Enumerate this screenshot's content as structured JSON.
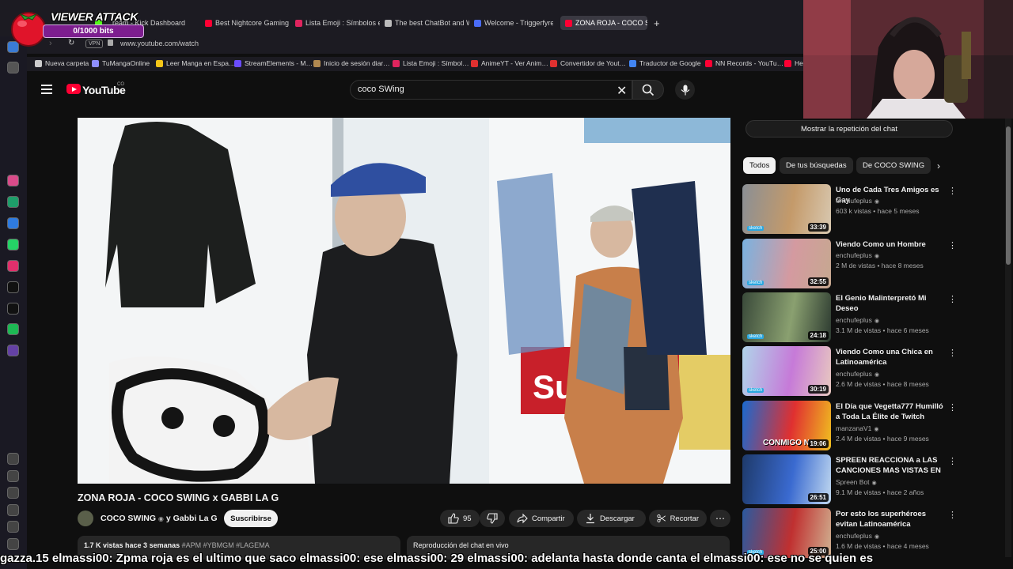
{
  "browser": {
    "tabs": [
      {
        "label": "…ream - Kick Dashboard",
        "color": "#53fc18"
      },
      {
        "label": "Best Nightcore Gaming M",
        "color": "#ff0033"
      },
      {
        "label": "Lista Emoji : Símbolos en",
        "color": "#e0245e"
      },
      {
        "label": "The best ChatBot and Wid",
        "color": "#bbbbbb"
      },
      {
        "label": "Welcome - Triggerfyre",
        "color": "#4a6cf7"
      },
      {
        "label": "ZONA ROJA - COCO S",
        "color": "#ff0033",
        "active": true
      }
    ],
    "new_tab": "+",
    "vpn_label": "VPN",
    "url": "www.youtube.com/watch",
    "bookmarks": [
      {
        "label": "Nueva carpeta",
        "color": "#cccccc"
      },
      {
        "label": "TuMangaOnline",
        "color": "#8f8fff"
      },
      {
        "label": "Leer Manga en Espa…",
        "color": "#f5c518"
      },
      {
        "label": "StreamElements - M…",
        "color": "#6a4cff"
      },
      {
        "label": "Inicio de sesión diar…",
        "color": "#b08850"
      },
      {
        "label": "Lista Emoji : Símbol…",
        "color": "#e0245e"
      },
      {
        "label": "AnimeYT - Ver Anim…",
        "color": "#e03030"
      },
      {
        "label": "Convertidor de Yout…",
        "color": "#e03030"
      },
      {
        "label": "Traductor de Google",
        "color": "#4285f4"
      },
      {
        "label": "NN Records - YouTu…",
        "color": "#ff0033"
      },
      {
        "label": "He",
        "color": "#ff0033"
      }
    ]
  },
  "sidebar_icons": [
    "home-icon",
    "pin-icon",
    "aria-icon",
    "chatgpt-icon",
    "messenger-icon",
    "whatsapp-icon",
    "instagram-icon",
    "tiktok-icon",
    "x-icon",
    "spotify-icon",
    "twitch-icon",
    "apps-icon",
    "heart-icon",
    "history-icon",
    "download-icon",
    "settings-icon",
    "more-icon"
  ],
  "youtube": {
    "wordmark": "YouTube",
    "country": "CO",
    "search_value": "coco SWing",
    "video": {
      "title": "ZONA ROJA - COCO SWING x GABBI LA G",
      "channel": "COCO SWING",
      "channel_suffix": "y Gabbi La G",
      "subscribe": "Suscribirse",
      "likes": "95",
      "share": "Compartir",
      "download": "Descargar",
      "clip": "Recortar",
      "more": "⋯",
      "views": "1.7 K vistas",
      "age": "hace 3 semanas",
      "tags": "#APM #YBMGM #LAGEMA",
      "chat_replay": "Reproducción del chat en vivo"
    },
    "show_chat_replay": "Mostrar la repetición del chat",
    "chips": [
      {
        "label": "Todos",
        "selected": true
      },
      {
        "label": "De tus búsquedas",
        "selected": false
      },
      {
        "label": "De COCO SWING",
        "selected": false
      }
    ],
    "chip_next": "›",
    "recommendations": [
      {
        "title": "Uno de Cada Tres Amigos es Gay",
        "channel": "enchufeplus",
        "verified": true,
        "views": "603 k vistas",
        "age": "hace 5 meses",
        "duration": "33:39",
        "sketch": true,
        "colors": [
          "#8a8f95",
          "#c49a6a",
          "#d8c8b0"
        ]
      },
      {
        "title": "Viendo Como un Hombre",
        "channel": "enchufeplus",
        "verified": true,
        "views": "2 M de vistas",
        "age": "hace 8 meses",
        "duration": "32:55",
        "sketch": true,
        "colors": [
          "#7ab2e0",
          "#d49aa0",
          "#c6a890"
        ]
      },
      {
        "title": "El Genio Malinterpretó Mi Deseo",
        "channel": "enchufeplus",
        "verified": true,
        "views": "3.1 M de vistas",
        "age": "hace 6 meses",
        "duration": "24:18",
        "sketch": true,
        "colors": [
          "#3a4a3a",
          "#8aa070",
          "#2c3a30"
        ]
      },
      {
        "title": "Viendo Como una Chica en Latinoamérica",
        "channel": "enchufeplus",
        "verified": true,
        "views": "2.6 M de vistas",
        "age": "hace 8 meses",
        "duration": "30:19",
        "sketch": true,
        "colors": [
          "#b0d4ea",
          "#c67ad8",
          "#e8c8c0"
        ]
      },
      {
        "title": "El Día que Vegetta777 Humilló a Toda La Élite de Twitch",
        "channel": "manzanaV1",
        "verified": true,
        "views": "2.4 M de vistas",
        "age": "hace 9 meses",
        "duration": "19:06",
        "overlay": "CONMIGO NO",
        "sketch": false,
        "colors": [
          "#1a6ad0",
          "#e03030",
          "#f0c020"
        ]
      },
      {
        "title": "SPREEN REACCIONA a LAS CANCIONES MAS VISTAS EN ...",
        "channel": "Spreen Bot",
        "verified": true,
        "views": "9.1 M de vistas",
        "age": "hace 2 años",
        "duration": "26:51",
        "sketch": false,
        "colors": [
          "#1e3a6a",
          "#3a6ad0",
          "#c0d8f0"
        ]
      },
      {
        "title": "Por esto los superhéroes evitan Latinoamérica",
        "channel": "enchufeplus",
        "verified": true,
        "views": "1.6 M de vistas",
        "age": "hace 4 meses",
        "duration": "25:00",
        "sketch": true,
        "colors": [
          "#2a5aa0",
          "#c03030",
          "#d0b090"
        ]
      }
    ]
  },
  "overlay": {
    "viewer_attack_title": "VIEWER ATTACK",
    "viewer_attack_progress": "0/1000 bits",
    "chat_ticker": "gazza.15 elmassi00: Zpma roja es el ultimo que saco elmassi00: ese elmassi00: 29 elmassi00: adelanta hasta donde canta el elmassi00: ese no se quien es"
  }
}
